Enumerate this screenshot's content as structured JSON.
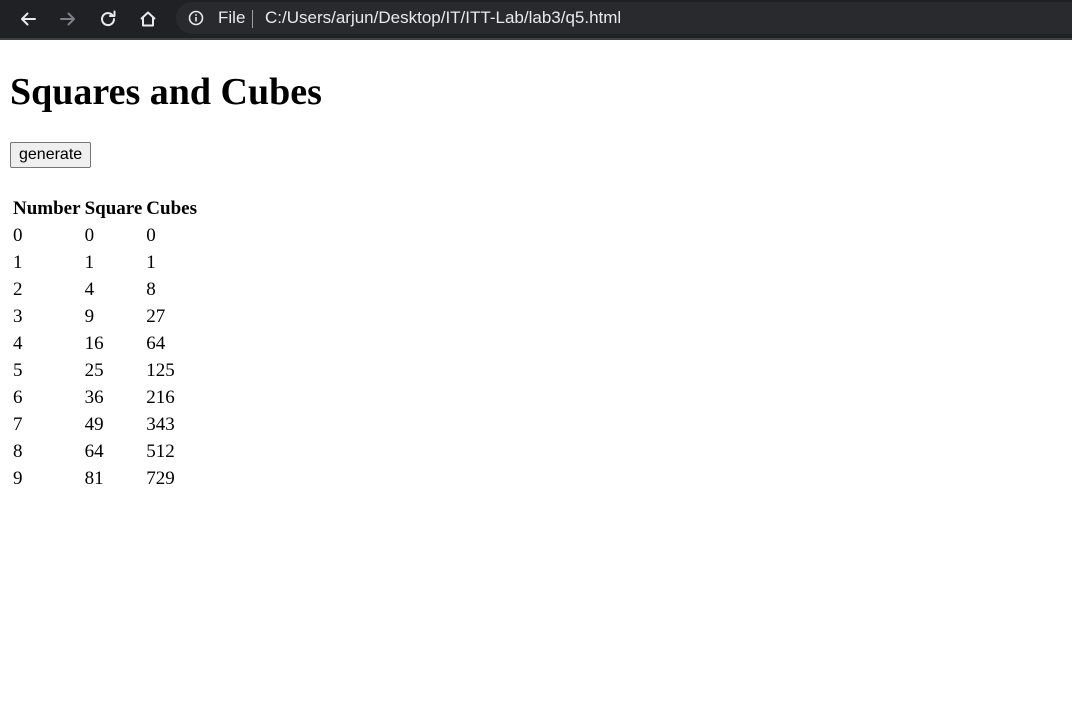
{
  "browser": {
    "scheme_label": "File",
    "url": "C:/Users/arjun/Desktop/IT/ITT-Lab/lab3/q5.html"
  },
  "page": {
    "title": "Squares and Cubes",
    "generate_label": "generate"
  },
  "table": {
    "headers": [
      "Number",
      "Square",
      "Cubes"
    ],
    "rows": [
      [
        "0",
        "0",
        "0"
      ],
      [
        "1",
        "1",
        "1"
      ],
      [
        "2",
        "4",
        "8"
      ],
      [
        "3",
        "9",
        "27"
      ],
      [
        "4",
        "16",
        "64"
      ],
      [
        "5",
        "25",
        "125"
      ],
      [
        "6",
        "36",
        "216"
      ],
      [
        "7",
        "49",
        "343"
      ],
      [
        "8",
        "64",
        "512"
      ],
      [
        "9",
        "81",
        "729"
      ]
    ]
  }
}
